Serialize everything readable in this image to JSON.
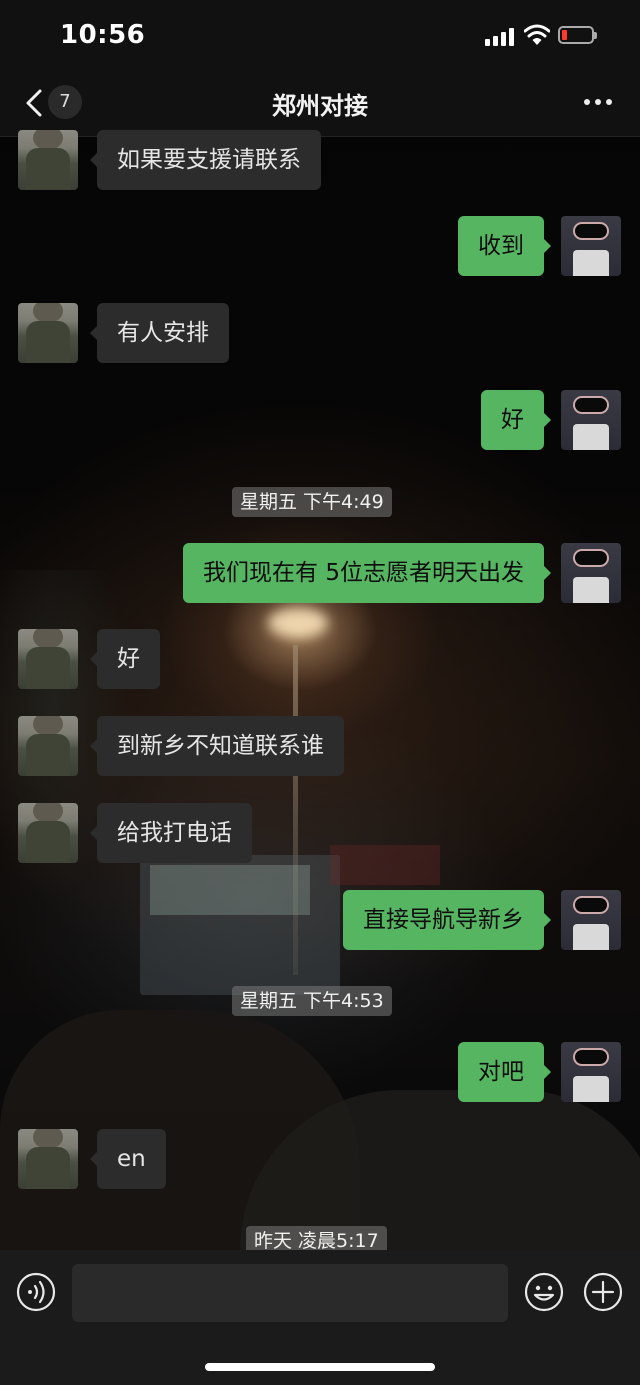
{
  "status_bar": {
    "time": "10:56"
  },
  "nav": {
    "unread_count": "7",
    "title": "郑州对接"
  },
  "messages": [
    {
      "side": "left",
      "text": "如果要支援请联系"
    },
    {
      "side": "right",
      "text": "收到"
    },
    {
      "side": "left",
      "text": "有人安排"
    },
    {
      "side": "right",
      "text": "好"
    },
    {
      "type": "time",
      "text": "星期五 下午4:49"
    },
    {
      "side": "right",
      "text": "我们现在有 5位志愿者明天出发"
    },
    {
      "side": "left",
      "text": "好"
    },
    {
      "side": "left",
      "text": "到新乡不知道联系谁"
    },
    {
      "side": "left",
      "text": "给我打电话"
    },
    {
      "side": "right",
      "text": "直接导航导新乡"
    },
    {
      "type": "time",
      "text": "星期五 下午4:53"
    },
    {
      "side": "right",
      "text": "对吧"
    },
    {
      "side": "left",
      "text": "en"
    },
    {
      "type": "time",
      "text": "昨天 凌晨5:17"
    }
  ],
  "input_bar": {
    "message_value": "",
    "icons": [
      "voice-icon",
      "emoji-icon",
      "plus-icon"
    ]
  },
  "colors": {
    "outgoing_bubble": "#56b561",
    "incoming_bubble": "#2c2c2c",
    "bar_background": "#111111",
    "battery_low": "#ff3b30"
  }
}
